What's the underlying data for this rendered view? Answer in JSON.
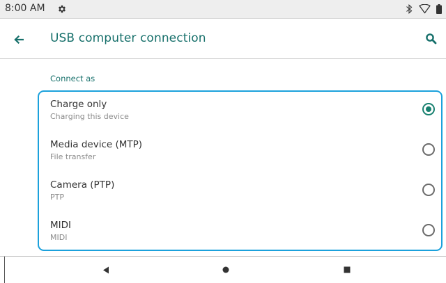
{
  "status_bar": {
    "time": "8:00 AM",
    "icons": [
      "gear-icon",
      "bluetooth-icon",
      "wifi-icon",
      "battery-icon"
    ]
  },
  "app_bar": {
    "title": "USB computer connection",
    "back_icon": "back-arrow-icon",
    "search_icon": "search-icon"
  },
  "section": {
    "header": "Connect as"
  },
  "options": [
    {
      "title": "Charge only",
      "subtitle": "Charging this device",
      "checked": true
    },
    {
      "title": "Media device (MTP)",
      "subtitle": "File transfer",
      "checked": false
    },
    {
      "title": "Camera (PTP)",
      "subtitle": "PTP",
      "checked": false
    },
    {
      "title": "MIDI",
      "subtitle": "MIDI",
      "checked": false
    }
  ],
  "nav_bar": {
    "buttons": [
      "back-triangle-icon",
      "home-circle-icon",
      "recents-square-icon"
    ]
  },
  "colors": {
    "accent": "#17706b",
    "highlight_border": "#1ba1dc",
    "status_bar_bg": "#eeeeee"
  }
}
